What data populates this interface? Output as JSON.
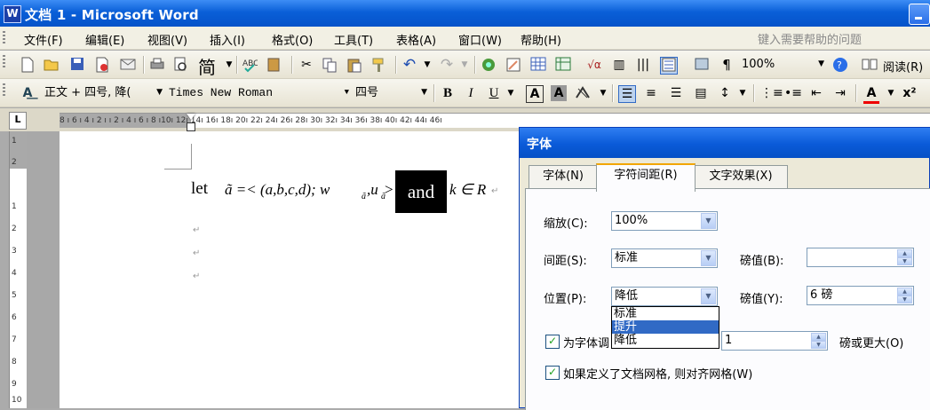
{
  "window": {
    "title": "文档 1 - Microsoft Word",
    "app_icon_glyph": "W"
  },
  "menu": {
    "items": [
      "文件(F)",
      "编辑(E)",
      "视图(V)",
      "插入(I)",
      "格式(O)",
      "工具(T)",
      "表格(A)",
      "窗口(W)",
      "帮助(H)"
    ],
    "help_placeholder": "键入需要帮助的问题"
  },
  "toolbar1": {
    "jian_label": "简",
    "zoom": "100%",
    "read_label": "阅读(R)"
  },
  "toolbar2": {
    "style": "正文 + 四号, 降(",
    "font": "Times New Roman",
    "size": "四号",
    "bold": "B",
    "italic": "I",
    "underline": "U",
    "x2": "x²"
  },
  "ruler": {
    "ticks": "8 ı 6 ı 4 ı 2 ı      ı 2 ı 4 ı 6 ı 8 ı10ı 12ı 14ı 16ı 18ı 20ı 22ı 24ı 26ı 28ı 30ı 32ı 34ı 36ı 38ı 40ı 42ı 44ı 46ı",
    "button": "L",
    "vticks": [
      "1",
      "2",
      "1",
      "2",
      "3",
      "4",
      "5",
      "6",
      "7",
      "8",
      "9",
      "10"
    ]
  },
  "document": {
    "let": "let",
    "formula_left": "ã =< (a,b,c,d); w",
    "sub1": "ã",
    "comma": ",u",
    "sub2": "ã",
    "gt": ">",
    "and": "and",
    "formula_right": "k ∈ R",
    "para_mark": "↵"
  },
  "dialog": {
    "title": "字体",
    "tabs": [
      "字体(N)",
      "字符间距(R)",
      "文字效果(X)"
    ],
    "scale_label": "缩放(C):",
    "scale_value": "100%",
    "spacing_label": "间距(S):",
    "spacing_value": "标准",
    "spacing_pt_label": "磅值(B):",
    "spacing_pt_value": "",
    "position_label": "位置(P):",
    "position_value": "降低",
    "position_pt_label": "磅值(Y):",
    "position_pt_value": "6 磅",
    "position_options": [
      "标准",
      "提升",
      "降低"
    ],
    "kerning_label": "为字体调",
    "kerning_value": "1",
    "kerning_suffix": "磅或更大(O)",
    "grid_label": "如果定义了文档网格, 则对齐网格(W)"
  }
}
